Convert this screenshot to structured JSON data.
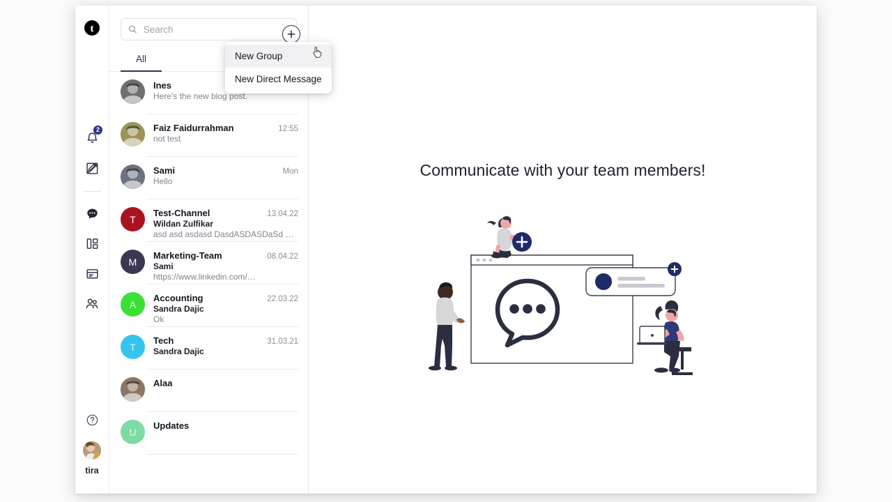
{
  "app": {
    "logo_letter": "t",
    "logo_name": "brand-logo"
  },
  "rail": {
    "items": [
      {
        "name": "notifications",
        "icon": "bell-icon",
        "badge": "2"
      },
      {
        "name": "compose",
        "icon": "compose-icon",
        "badge": ""
      },
      {
        "name": "chats",
        "icon": "chat-bubble-icon",
        "badge": ""
      },
      {
        "name": "dashboard",
        "icon": "dashboard-grid-icon",
        "badge": ""
      },
      {
        "name": "calendar",
        "icon": "calendar-icon",
        "badge": ""
      },
      {
        "name": "contacts",
        "icon": "people-icon",
        "badge": ""
      }
    ],
    "help_icon": "help-circle-icon",
    "username": "tira"
  },
  "search": {
    "placeholder": "Search",
    "value": "",
    "icon": "search-icon"
  },
  "new_button": {
    "icon": "plus-circle-icon",
    "label": "+"
  },
  "tabs": [
    {
      "label": "All",
      "active": true
    }
  ],
  "dropdown": {
    "items": [
      {
        "label": "New Group",
        "hovered": true
      },
      {
        "label": "New Direct Message",
        "hovered": false
      }
    ],
    "cursor_icon": "pointer-cursor-icon"
  },
  "conversations": [
    {
      "title": "Ines",
      "time": "",
      "sender": "",
      "preview": "Here's the new blog post.",
      "avatar_type": "photo",
      "avatar_letter": "",
      "avatar_color": "#6f6f6f"
    },
    {
      "title": "Faiz Faidurrahman",
      "time": "12:55",
      "sender": "",
      "preview": "not test",
      "avatar_type": "photo",
      "avatar_letter": "",
      "avatar_color": "#9d9457"
    },
    {
      "title": "Sami",
      "time": "Mon",
      "sender": "",
      "preview": "Hello",
      "avatar_type": "photo",
      "avatar_letter": "",
      "avatar_color": "#6d737d"
    },
    {
      "title": "Test-Channel",
      "time": "13.04.22",
      "sender": "Wildan Zulfikar",
      "preview": "asd asd asdasd DasdASDASDaSd asd A…",
      "avatar_type": "letter",
      "avatar_letter": "T",
      "avatar_color": "#ab1220"
    },
    {
      "title": "Marketing-Team",
      "time": "08.04.22",
      "sender": "Sami",
      "preview": "https://www.linkedin.com/…",
      "avatar_type": "letter",
      "avatar_letter": "M",
      "avatar_color": "#3c3752"
    },
    {
      "title": "Accounting",
      "time": "22.03.22",
      "sender": "Sandra Dajic",
      "preview": "Ok",
      "avatar_type": "letter",
      "avatar_letter": "A",
      "avatar_color": "#3ae034"
    },
    {
      "title": "Tech",
      "time": "31.03.21",
      "sender": "Sandra Dajic",
      "preview": "",
      "avatar_type": "letter",
      "avatar_letter": "T",
      "avatar_color": "#35c4ee"
    },
    {
      "title": "Alaa",
      "time": "",
      "sender": "",
      "preview": "",
      "avatar_type": "photo",
      "avatar_letter": "",
      "avatar_color": "#8c7764"
    },
    {
      "title": "Updates",
      "time": "",
      "sender": "",
      "preview": "",
      "avatar_type": "letter",
      "avatar_letter": "U",
      "avatar_color": "#7ddba4"
    }
  ],
  "main": {
    "empty_title": "Communicate with your team members!",
    "illustration_name": "team-communication-illustration"
  },
  "colors": {
    "accent": "#2e3192",
    "text": "#14161f",
    "muted": "#83838c",
    "border": "#e9e9ec",
    "tab_active": "#2b3566"
  }
}
